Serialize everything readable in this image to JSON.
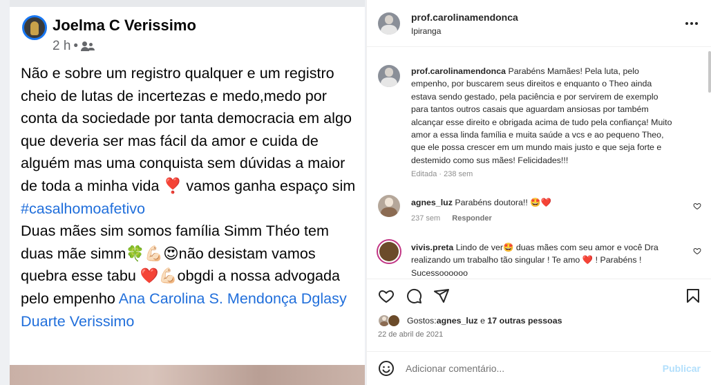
{
  "facebook_post": {
    "author": "Joelma C Verissimo",
    "time": "2 h",
    "dot": "•",
    "paragraphs": [
      "Não e sobre um registro qualquer e um registro cheio de lutas de incertezas e medo,medo por conta da sociedade por tanta democracia em algo que deveria ser mas fácil da amor e cuida de alguém mas uma conquista sem dúvidas a maior de toda a minha vida ❣️ vamos ganha espaço sim",
      "Duas mães sim somos família Simm Théo tem duas mãe simm🍀💪🏻😍não desistam vamos quebra esse tabu ❤️💪🏻obgdi a nossa advogada pelo empenho "
    ],
    "hashtag": "#casalhomoafetivo",
    "tagged": "Ana Carolina S. Mendonça Dglasy Duarte Verissimo"
  },
  "instagram": {
    "header": {
      "username": "prof.carolinamendonca",
      "location": "Ipiranga"
    },
    "caption": {
      "username": "prof.carolinamendonca",
      "text": "Parabéns Mamães! Pela luta, pelo empenho, por buscarem seus direitos e enquanto o Theo ainda estava sendo gestado, pela paciência e por servirem de exemplo para tantos outros casais que aguardam ansiosas por também alcançar esse direito e obrigada acima de tudo pela confiança! Muito amor a essa linda família e muita saúde a vcs e ao pequeno Theo, que ele possa crescer em um mundo mais justo e que seja forte e destemido como sus mães! Felicidades!!!",
      "meta": "Editada · 238 sem"
    },
    "comments": [
      {
        "username": "agnes_luz",
        "text": "Parabéns doutora!! 🤩❤️",
        "age": "237 sem",
        "reply": "Responder"
      },
      {
        "username": "vivis.preta",
        "text": "Lindo de ver🤩 duas mães com seu amor e você Dra realizando um trabalho tão singular ! Te amo ❤️ ! Parabéns ! Sucessoooooo"
      }
    ],
    "likes": {
      "prefix": "Gostos: ",
      "user": "agnes_luz",
      "middle": " e ",
      "others": "17 outras pessoas"
    },
    "date": "22 de abril de 2021",
    "add_comment_placeholder": "Adicionar comentário...",
    "publish_label": "Publicar",
    "icons": {
      "more": "more-options-icon",
      "like": "heart-icon",
      "comment": "comment-icon",
      "share": "share-icon",
      "save": "bookmark-icon",
      "emoji": "emoji-icon"
    }
  }
}
